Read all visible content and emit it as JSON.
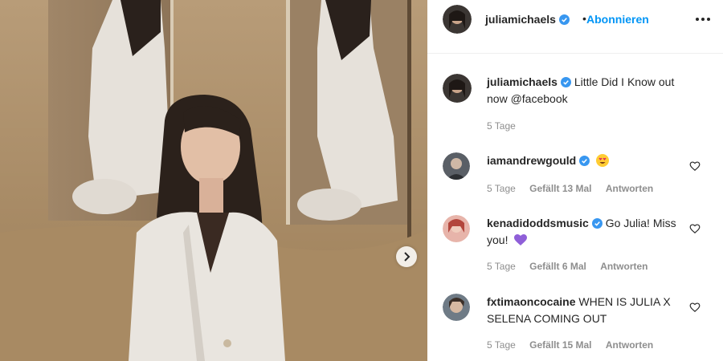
{
  "post": {
    "author": "juliamichaels",
    "follow_label": "Abonnieren",
    "dot": "•",
    "caption_text": "Little Did I Know out now @facebook",
    "caption_time": "5 Tage"
  },
  "comments": [
    {
      "user": "iamandrewgould",
      "text": "",
      "emoji": "heart-eyes-emoji",
      "time": "5 Tage",
      "likes": "Gefällt 13 Mal",
      "reply": "Antworten"
    },
    {
      "user": "kenadidoddsmusic",
      "text": "Go Julia! Miss you!",
      "emoji": "purple-heart-emoji",
      "time": "5 Tage",
      "likes": "Gefällt 6 Mal",
      "reply": "Antworten"
    },
    {
      "user": "fxtimaoncocaine",
      "text": "WHEN IS JULIA X SELENA COMING OUT",
      "emoji": "",
      "time": "5 Tage",
      "likes": "Gefällt 15 Mal",
      "reply": "Antworten"
    }
  ],
  "colors": {
    "accent": "#0095f6",
    "verified": "#3897f0",
    "meta": "#8e8e8e"
  },
  "icons": {
    "verified": "verified-badge-icon",
    "more": "more-options-icon",
    "like": "heart-outline-icon",
    "next": "chevron-right-icon"
  }
}
